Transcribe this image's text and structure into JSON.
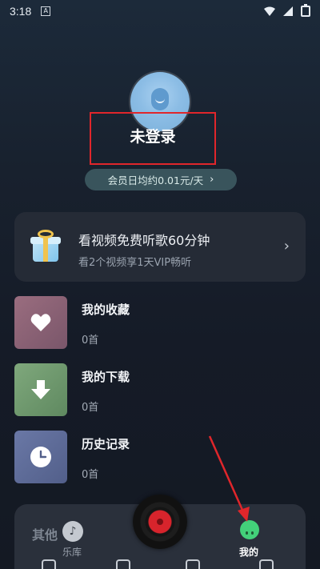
{
  "status_bar": {
    "time": "3:18",
    "app_indicator": "A"
  },
  "profile": {
    "login_label": "未登录",
    "vip_pill_label": "会员日均约0.01元/天",
    "vip_pill_chevron": "›"
  },
  "promo": {
    "title": "看视频免费听歌60分钟",
    "subtitle": "看2个视频享1天VIP畅听",
    "chevron": "›"
  },
  "library_items": [
    {
      "title": "我的收藏",
      "count": "0首",
      "icon": "heart-icon"
    },
    {
      "title": "我的下载",
      "count": "0首",
      "icon": "download-arrow-icon"
    },
    {
      "title": "历史记录",
      "count": "0首",
      "icon": "clock-icon"
    }
  ],
  "bottom_nav": {
    "other_label": "其他",
    "library_label": "乐库",
    "mine_label": "我的",
    "music_note": "♪"
  },
  "colors": {
    "highlight_box": "#e0262b",
    "annotation_arrow": "#e0262b",
    "mine_green": "#43d17a",
    "vinyl_red": "#d8242c"
  }
}
